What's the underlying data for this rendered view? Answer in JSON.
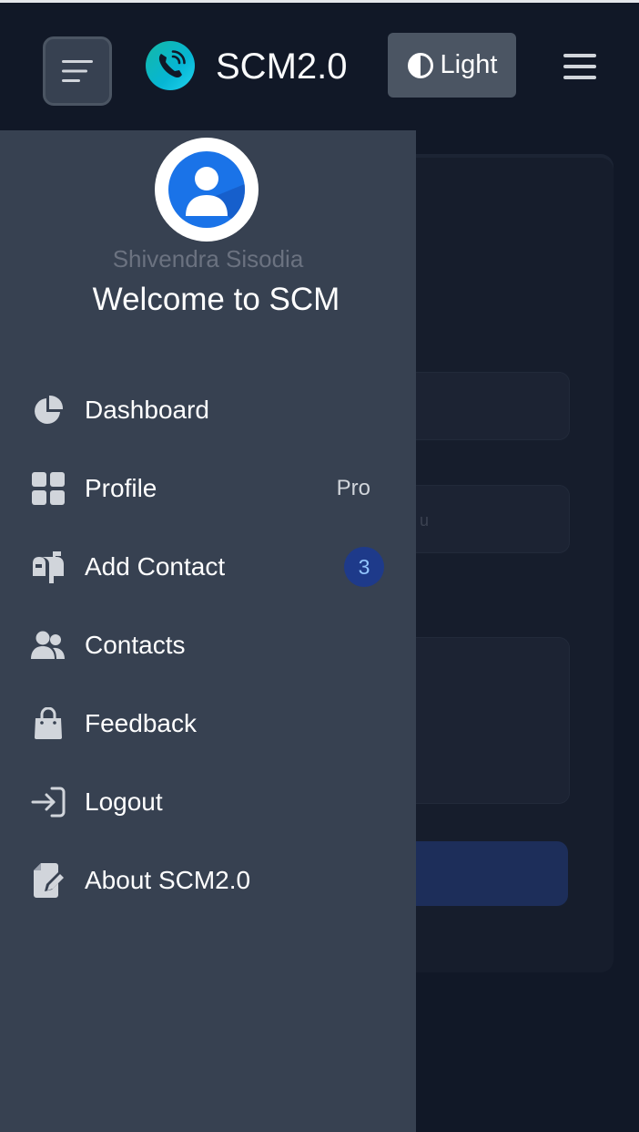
{
  "navbar": {
    "brand_name": "SCM2.0",
    "theme_toggle_label": "Light"
  },
  "background_form": {
    "field2_partial_text": "u"
  },
  "sidebar": {
    "user_name": "Shivendra Sisodia",
    "welcome_text": "Welcome to SCM",
    "items": [
      {
        "label": "Dashboard",
        "icon": "pie-chart-icon"
      },
      {
        "label": "Profile",
        "icon": "grid-icon",
        "tag": "Pro"
      },
      {
        "label": "Add Contact",
        "icon": "mailbox-icon",
        "badge": "3"
      },
      {
        "label": "Contacts",
        "icon": "users-icon"
      },
      {
        "label": "Feedback",
        "icon": "shopping-bag-icon"
      },
      {
        "label": "Logout",
        "icon": "sign-in-icon"
      },
      {
        "label": "About SCM2.0",
        "icon": "edit-file-icon"
      }
    ]
  },
  "colors": {
    "navbar_bg": "#111827",
    "sidebar_bg": "#374151",
    "badge_bg": "#1e3a8a",
    "brand_gradient": "#14b8a6"
  }
}
